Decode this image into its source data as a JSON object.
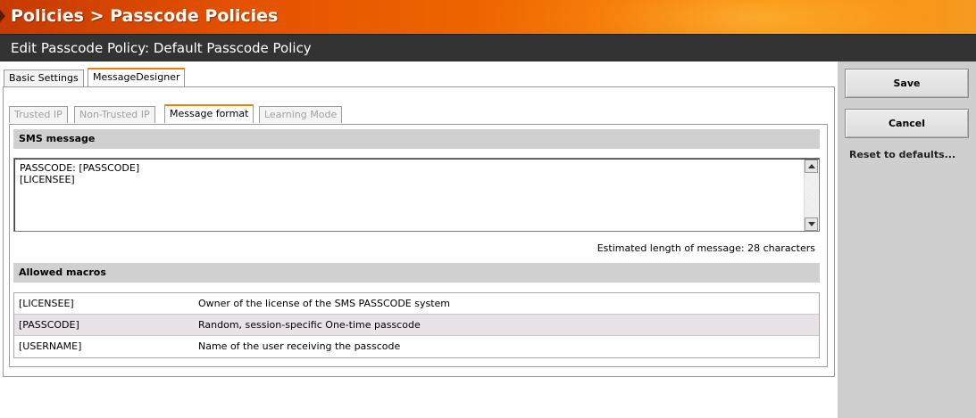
{
  "header": {
    "title": "Policies > Passcode Policies",
    "subtitle": "Edit Passcode Policy: Default Passcode Policy",
    "accent": "#f07000"
  },
  "tabs": [
    {
      "label": "Basic Settings",
      "active": false
    },
    {
      "label": "MessageDesigner",
      "active": true
    }
  ],
  "subtabs": [
    {
      "label": "Trusted IP",
      "enabled": false
    },
    {
      "label": "Non-Trusted IP",
      "enabled": false
    },
    {
      "label": "Message format",
      "enabled": true,
      "active": true
    },
    {
      "label": "Learning Mode",
      "enabled": false
    }
  ],
  "sms_section": {
    "title": "SMS message",
    "message": "PASSCODE: [PASSCODE]\n[LICENSEE]",
    "estimate": "Estimated length of message: 28 characters"
  },
  "macros_section": {
    "title": "Allowed macros",
    "rows": [
      {
        "macro": "[LICENSEE]",
        "description": "Owner of the license of the SMS PASSCODE system"
      },
      {
        "macro": "[PASSCODE]",
        "description": "Random, session-specific One-time passcode"
      },
      {
        "macro": "[USERNAME]",
        "description": "Name of the user receiving the passcode"
      }
    ]
  },
  "actions": {
    "save": "Save",
    "cancel": "Cancel",
    "reset": "Reset to defaults..."
  }
}
